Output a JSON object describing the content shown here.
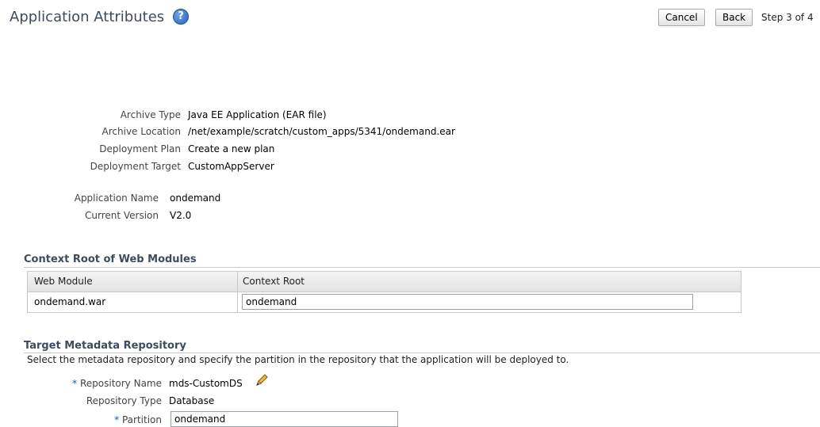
{
  "header": {
    "title": "Application Attributes",
    "help_glyph": "?",
    "cancel_label": "Cancel",
    "back_label": "Back",
    "step_text": "Step 3 of 4"
  },
  "archive": {
    "type_label": "Archive Type",
    "type_value": "Java EE Application (EAR file)",
    "location_label": "Archive Location",
    "location_value": "/net/example/scratch/custom_apps/5341/ondemand.ear",
    "plan_label": "Deployment Plan",
    "plan_value": "Create a new plan",
    "target_label": "Deployment Target",
    "target_value": "CustomAppServer"
  },
  "application": {
    "name_label": "Application Name",
    "name_value": "ondemand",
    "version_label": "Current Version",
    "version_value": "V2.0"
  },
  "context_root": {
    "heading": "Context Root of Web Modules",
    "col_module": "Web Module",
    "col_root": "Context Root",
    "rows": [
      {
        "module": "ondemand.war",
        "root": "ondemand"
      }
    ]
  },
  "metadata_repo": {
    "heading": "Target Metadata Repository",
    "description": "Select the metadata repository and specify the partition in the repository that the application will be deployed to.",
    "required_mark": "*",
    "repo_name_label": "Repository Name",
    "repo_name_value": "mds-CustomDS",
    "repo_type_label": "Repository Type",
    "repo_type_value": "Database",
    "partition_label": "Partition",
    "partition_value": "ondemand"
  },
  "icons": {
    "help": "help-icon",
    "edit": "pencil-icon"
  },
  "colors": {
    "title": "#3d4b5e",
    "required": "#1a57b3",
    "border": "#c8c8c8"
  }
}
